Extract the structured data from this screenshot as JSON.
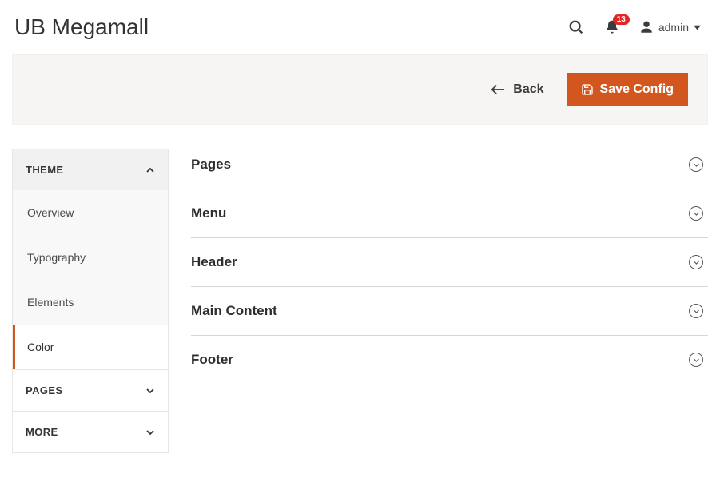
{
  "header": {
    "title": "UB Megamall",
    "notification_count": "13",
    "user_label": "admin"
  },
  "toolbar": {
    "back_label": "Back",
    "save_label": "Save Config"
  },
  "sidebar": {
    "sections": [
      {
        "label": "THEME",
        "expanded": true,
        "items": [
          {
            "label": "Overview",
            "active": false
          },
          {
            "label": "Typography",
            "active": false
          },
          {
            "label": "Elements",
            "active": false
          },
          {
            "label": "Color",
            "active": true
          }
        ]
      },
      {
        "label": "PAGES",
        "expanded": false,
        "items": []
      },
      {
        "label": "MORE",
        "expanded": false,
        "items": []
      }
    ]
  },
  "panels": [
    {
      "label": "Pages"
    },
    {
      "label": "Menu"
    },
    {
      "label": "Header"
    },
    {
      "label": "Main Content"
    },
    {
      "label": "Footer"
    }
  ]
}
